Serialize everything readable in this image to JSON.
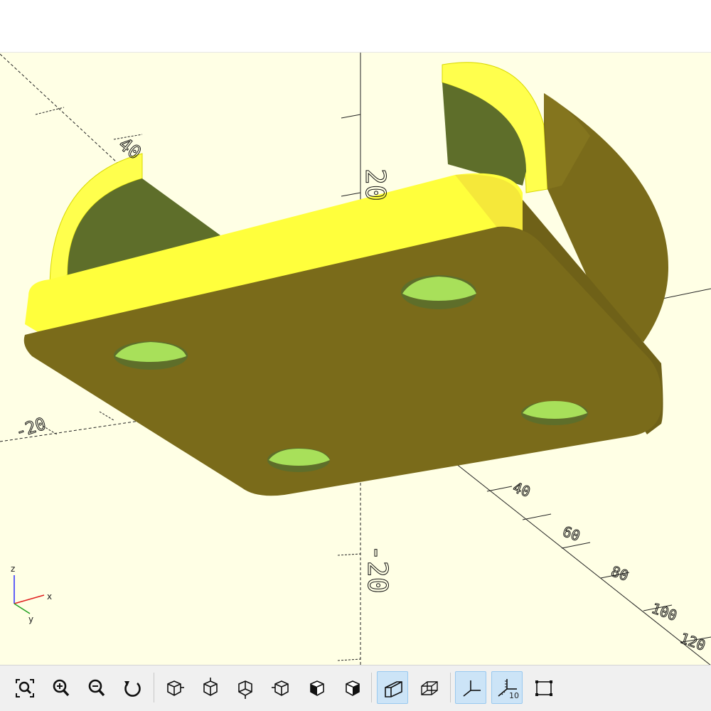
{
  "viewport": {
    "background": "#ffffe5",
    "model_color_light": "#ffff4d",
    "model_color_dark": "#7a6b1a",
    "hole_color": "#a8e05a",
    "axis_labels": {
      "z_positive": "20",
      "z_negative": "-20",
      "y_positive": "40",
      "x_negative": "-20",
      "x_ticks": [
        "40",
        "60",
        "80",
        "100",
        "120"
      ]
    },
    "gizmo": {
      "z": "z",
      "x": "x",
      "y": "y"
    }
  },
  "toolbar": {
    "buttons": [
      {
        "name": "view-all-button",
        "icon": "zoom-fit-icon",
        "tooltip": "View All"
      },
      {
        "name": "zoom-in-button",
        "icon": "zoom-in-icon",
        "tooltip": "Zoom In"
      },
      {
        "name": "zoom-out-button",
        "icon": "zoom-out-icon",
        "tooltip": "Zoom Out"
      },
      {
        "name": "reset-view-button",
        "icon": "reset-view-icon",
        "tooltip": "Reset View"
      },
      {
        "name": "view-right-button",
        "icon": "view-right-icon",
        "tooltip": "Right"
      },
      {
        "name": "view-top-button",
        "icon": "view-top-icon",
        "tooltip": "Top"
      },
      {
        "name": "view-bottom-button",
        "icon": "view-bottom-icon",
        "tooltip": "Bottom"
      },
      {
        "name": "view-left-button",
        "icon": "view-left-icon",
        "tooltip": "Left"
      },
      {
        "name": "view-front-button",
        "icon": "view-front-icon",
        "tooltip": "Front"
      },
      {
        "name": "view-back-button",
        "icon": "view-back-icon",
        "tooltip": "Back"
      },
      {
        "name": "perspective-button",
        "icon": "perspective-icon",
        "tooltip": "Perspective",
        "active": true
      },
      {
        "name": "orthogonal-button",
        "icon": "orthogonal-icon",
        "tooltip": "Orthogonal"
      },
      {
        "name": "show-axes-button",
        "icon": "axes-icon",
        "tooltip": "Show Axes",
        "active": true
      },
      {
        "name": "show-scale-markers-button",
        "icon": "scale-markers-icon",
        "tooltip": "Show Scale Markers",
        "active": true,
        "badge": "10"
      },
      {
        "name": "show-edges-button",
        "icon": "edges-icon",
        "tooltip": "Show Edges"
      }
    ]
  }
}
